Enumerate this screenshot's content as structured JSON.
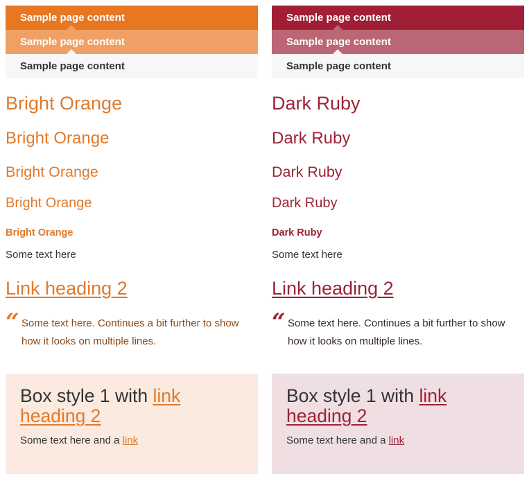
{
  "themes": [
    {
      "name": "Bright Orange",
      "accent_color": "#e87722",
      "bars": [
        "Sample page content",
        "Sample page content",
        "Sample page content"
      ],
      "headings": [
        "Bright Orange",
        "Bright Orange",
        "Bright Orange",
        "Bright Orange",
        "Bright Orange"
      ],
      "body_text": "Some text here",
      "link_heading": "Link heading 2",
      "quote_mark": "“",
      "quote_text": "Some text here. Continues a bit further to show how it looks on multiple lines.",
      "box": {
        "title_prefix": "Box style 1 with ",
        "title_link": "link heading 2",
        "text_prefix": "Some text here and a ",
        "text_link": "link"
      }
    },
    {
      "name": "Dark Ruby",
      "accent_color": "#a01f36",
      "bars": [
        "Sample page content",
        "Sample page content",
        "Sample page content"
      ],
      "headings": [
        "Dark Ruby",
        "Dark Ruby",
        "Dark Ruby",
        "Dark Ruby",
        "Dark Ruby"
      ],
      "body_text": "Some text here",
      "link_heading": "Link heading 2",
      "quote_mark": "“",
      "quote_text": "Some text here. Continues a bit further to show how it looks on multiple lines.",
      "box": {
        "title_prefix": "Box style 1 with ",
        "title_link": "link heading 2",
        "text_prefix": "Some text here and a ",
        "text_link": "link"
      }
    }
  ]
}
